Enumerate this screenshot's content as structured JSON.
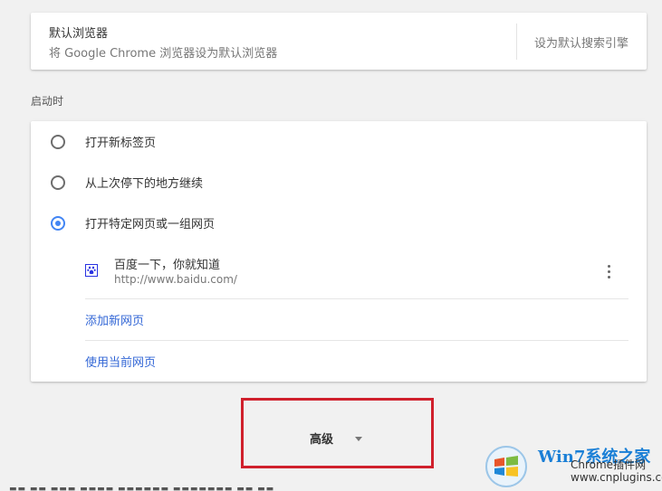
{
  "default_browser": {
    "title": "默认浏览器",
    "description": "将 Google Chrome 浏览器设为默认浏览器",
    "button_label": "设为默认搜索引擎"
  },
  "startup": {
    "heading": "启动时",
    "options": [
      {
        "label": "打开新标签页",
        "checked": false
      },
      {
        "label": "从上次停下的地方继续",
        "checked": false
      },
      {
        "label": "打开特定网页或一组网页",
        "checked": true
      }
    ],
    "pages": [
      {
        "name": "百度一下，你就知道",
        "url": "http://www.baidu.com/",
        "icon": "baidu-paw-icon"
      }
    ],
    "add_page_label": "添加新网页",
    "use_current_label": "使用当前网页"
  },
  "advanced": {
    "label": "高级",
    "icon": "chevron-down-icon"
  },
  "annotation": {
    "highlight_color": "#d0202c"
  },
  "watermark": {
    "brand": "Win7系统之家",
    "line1": "Chrome插件网",
    "line2": "www.cnplugins.com"
  },
  "colors": {
    "accent": "#4285f4",
    "link": "#3367d6"
  }
}
